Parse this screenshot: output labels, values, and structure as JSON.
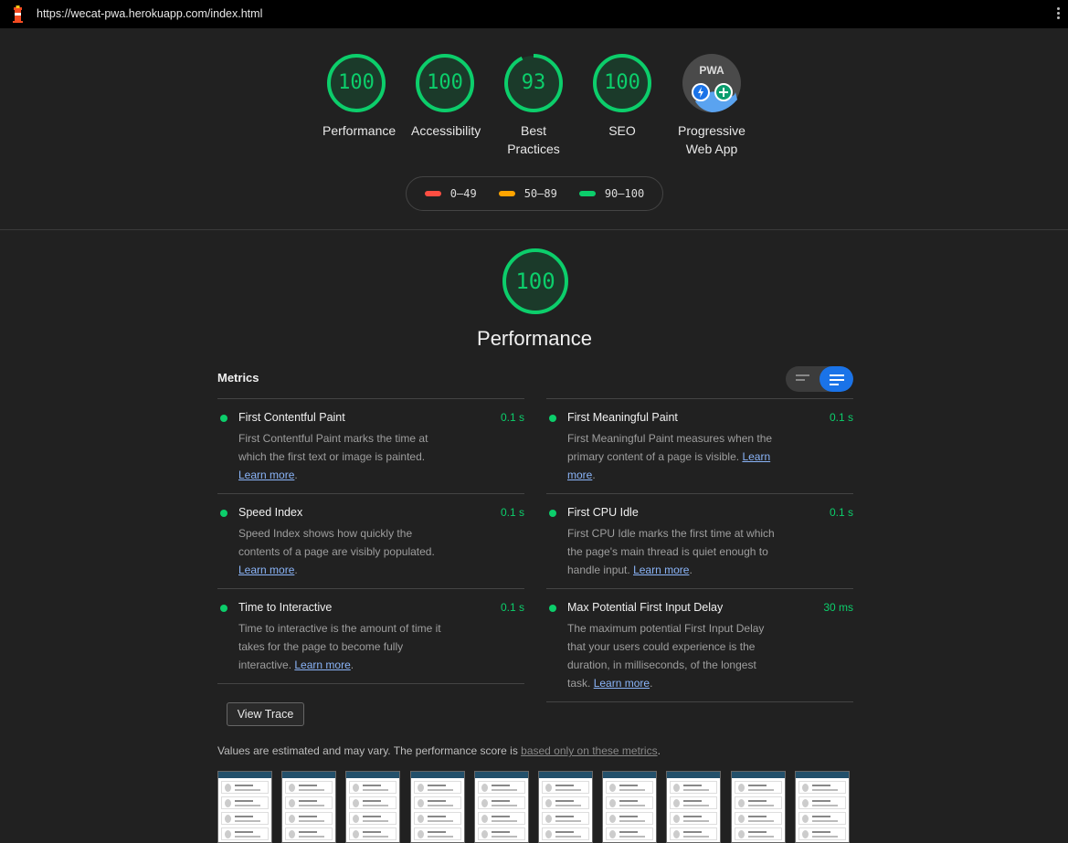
{
  "browser": {
    "url": "https://wecat-pwa.herokuapp.com/index.html"
  },
  "summary": {
    "gauges": [
      {
        "label": "Performance",
        "score": "100",
        "fraction": 1.0
      },
      {
        "label": "Accessibility",
        "score": "100",
        "fraction": 1.0
      },
      {
        "label": "Best Practices",
        "score": "93",
        "fraction": 0.93
      },
      {
        "label": "SEO",
        "score": "100",
        "fraction": 1.0
      }
    ],
    "pwa": {
      "label": "Progressive Web App",
      "badge": "PWA"
    }
  },
  "legend": [
    {
      "range": "0–49",
      "color": "#ff4e42"
    },
    {
      "range": "50–89",
      "color": "#ffa400"
    },
    {
      "range": "90–100",
      "color": "#0cce6b"
    }
  ],
  "performance": {
    "score": "100",
    "title": "Performance",
    "metrics_title": "Metrics",
    "left_metrics": [
      {
        "name": "First Contentful Paint",
        "value": "0.1 s",
        "desc": "First Contentful Paint marks the time at which the first text or image is painted.",
        "link": "Learn more"
      },
      {
        "name": "Speed Index",
        "value": "0.1 s",
        "desc": "Speed Index shows how quickly the contents of a page are visibly populated.",
        "link": "Learn more"
      },
      {
        "name": "Time to Interactive",
        "value": "0.1 s",
        "desc": "Time to interactive is the amount of time it takes for the page to become fully interactive.",
        "link": "Learn more"
      }
    ],
    "right_metrics": [
      {
        "name": "First Meaningful Paint",
        "value": "0.1 s",
        "desc": "First Meaningful Paint measures when the primary content of a page is visible.",
        "link": "Learn more"
      },
      {
        "name": "First CPU Idle",
        "value": "0.1 s",
        "desc": "First CPU Idle marks the first time at which the page's main thread is quiet enough to handle input.",
        "link": "Learn more"
      },
      {
        "name": "Max Potential First Input Delay",
        "value": "30 ms",
        "desc": "The maximum potential First Input Delay that your users could experience is the duration, in milliseconds, of the longest task.",
        "link": "Learn more"
      }
    ],
    "view_trace": "View Trace",
    "note": "Values are estimated and may vary. The performance score is ",
    "note_link": "based only on these metrics",
    "note_end": ".",
    "filmstrip_count": 10
  },
  "colors": {
    "pass": "#0cce6b",
    "accent": "#1a73e8"
  }
}
